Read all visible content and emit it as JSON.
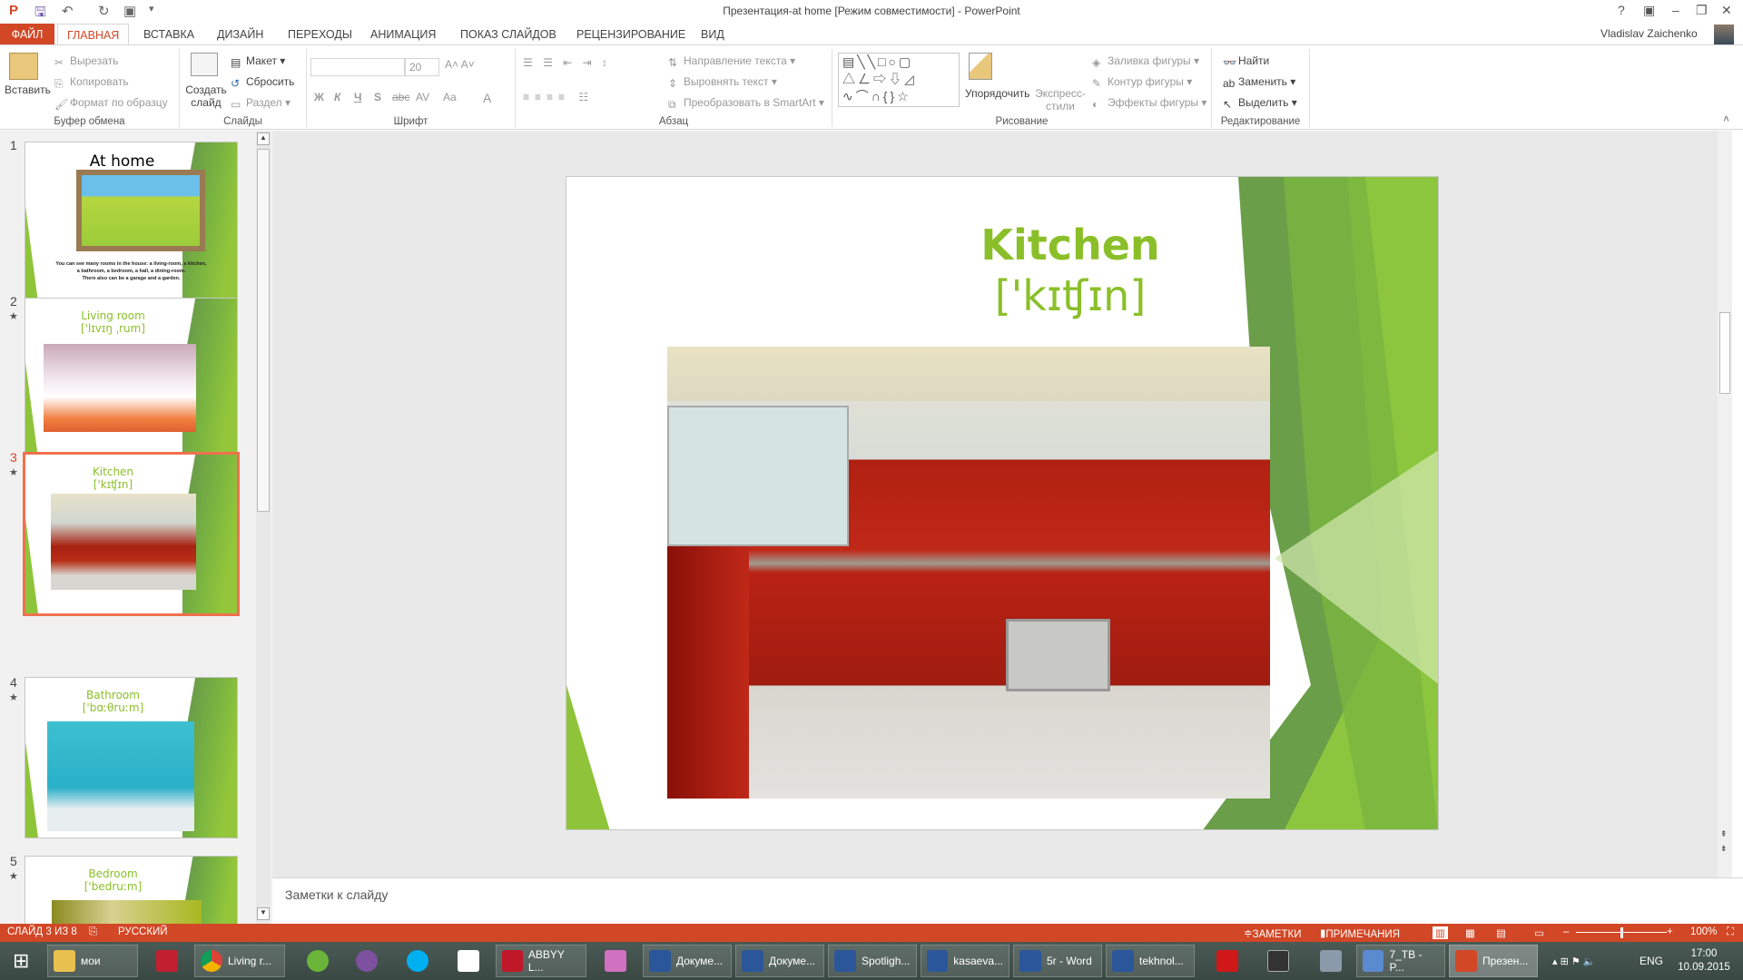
{
  "window": {
    "title": "Презентация-at home [Режим совместимости] - PowerPoint",
    "user": "Vladislav Zaichenko",
    "help": "?",
    "controls": [
      "▣",
      "–",
      "❐",
      "✕"
    ]
  },
  "tabs": [
    "ФАЙЛ",
    "ГЛАВНАЯ",
    "ВСТАВКА",
    "ДИЗАЙН",
    "ПЕРЕХОДЫ",
    "АНИМАЦИЯ",
    "ПОКАЗ СЛАЙДОВ",
    "РЕЦЕНЗИРОВАНИЕ",
    "ВИД"
  ],
  "ribbon": {
    "clipboard": {
      "label": "Буфер обмена",
      "paste": "Вставить",
      "cut": "Вырезать",
      "copy": "Копировать",
      "format_painter": "Формат по образцу"
    },
    "slides": {
      "label": "Слайды",
      "new_slide": "Создать слайд",
      "layout": "Макет",
      "reset": "Сбросить",
      "section": "Раздел"
    },
    "font": {
      "label": "Шрифт",
      "font_name": "",
      "font_size": "20",
      "bold": "Ж",
      "italic": "К",
      "underline": "Ч",
      "shadow": "S",
      "strike": "abc",
      "spacing": "AV",
      "case": "Aa",
      "color": "A"
    },
    "paragraph": {
      "label": "Абзац",
      "text_direction": "Направление текста",
      "align_text": "Выровнять текст",
      "smartart": "Преобразовать в SmartArt"
    },
    "drawing": {
      "label": "Рисование",
      "arrange": "Упорядочить",
      "quick_styles": "Экспресс-стили",
      "fill": "Заливка фигуры",
      "outline": "Контур фигуры",
      "effects": "Эффекты фигуры"
    },
    "editing": {
      "label": "Редактирование",
      "find": "Найти",
      "replace": "Заменить",
      "select": "Выделить"
    }
  },
  "thumbnails": [
    {
      "num": "1",
      "title": "At home",
      "caption": [
        "You can see many rooms in the house: a living-room, a kitchen,",
        "a bathroom, a bedroom, a hall, a dining-room.",
        "There also can be a garage and a garden."
      ],
      "star": false
    },
    {
      "num": "2",
      "title": "Living room",
      "phonetic": "['lɪvɪŋ ˌrum]",
      "star": true
    },
    {
      "num": "3",
      "title": "Kitchen",
      "phonetic": "['kɪʧɪn]",
      "star": true,
      "selected": true
    },
    {
      "num": "4",
      "title": "Bathroom",
      "phonetic": "['bɑːθruːm]",
      "star": true
    },
    {
      "num": "5",
      "title": "Bedroom",
      "phonetic": "['bedruːm]",
      "star": true
    }
  ],
  "slide": {
    "title": "Kitchen",
    "phonetic": "['kɪʧɪn]",
    "accent": "#8bbf2a"
  },
  "notes": {
    "placeholder": "Заметки к слайду"
  },
  "status": {
    "slide": "СЛАЙД 3 ИЗ 8",
    "language": "РУССКИЙ",
    "notes": "ЗАМЕТКИ",
    "comments": "ПРИМЕЧАНИЯ",
    "zoom": "100%",
    "zoom_level": 100
  },
  "taskbar": {
    "items": [
      "мои",
      "",
      "Living r...",
      "",
      "",
      "",
      "",
      "ABBYY L...",
      "",
      "Докуме...",
      "Докуме...",
      "Spotligh...",
      "kasaeva...",
      "5r - Word",
      "tekhnol...",
      "",
      "",
      "",
      "7_TB - P...",
      "Презен..."
    ],
    "lang": "ENG",
    "time": "17:00",
    "date": "10.09.2015"
  }
}
